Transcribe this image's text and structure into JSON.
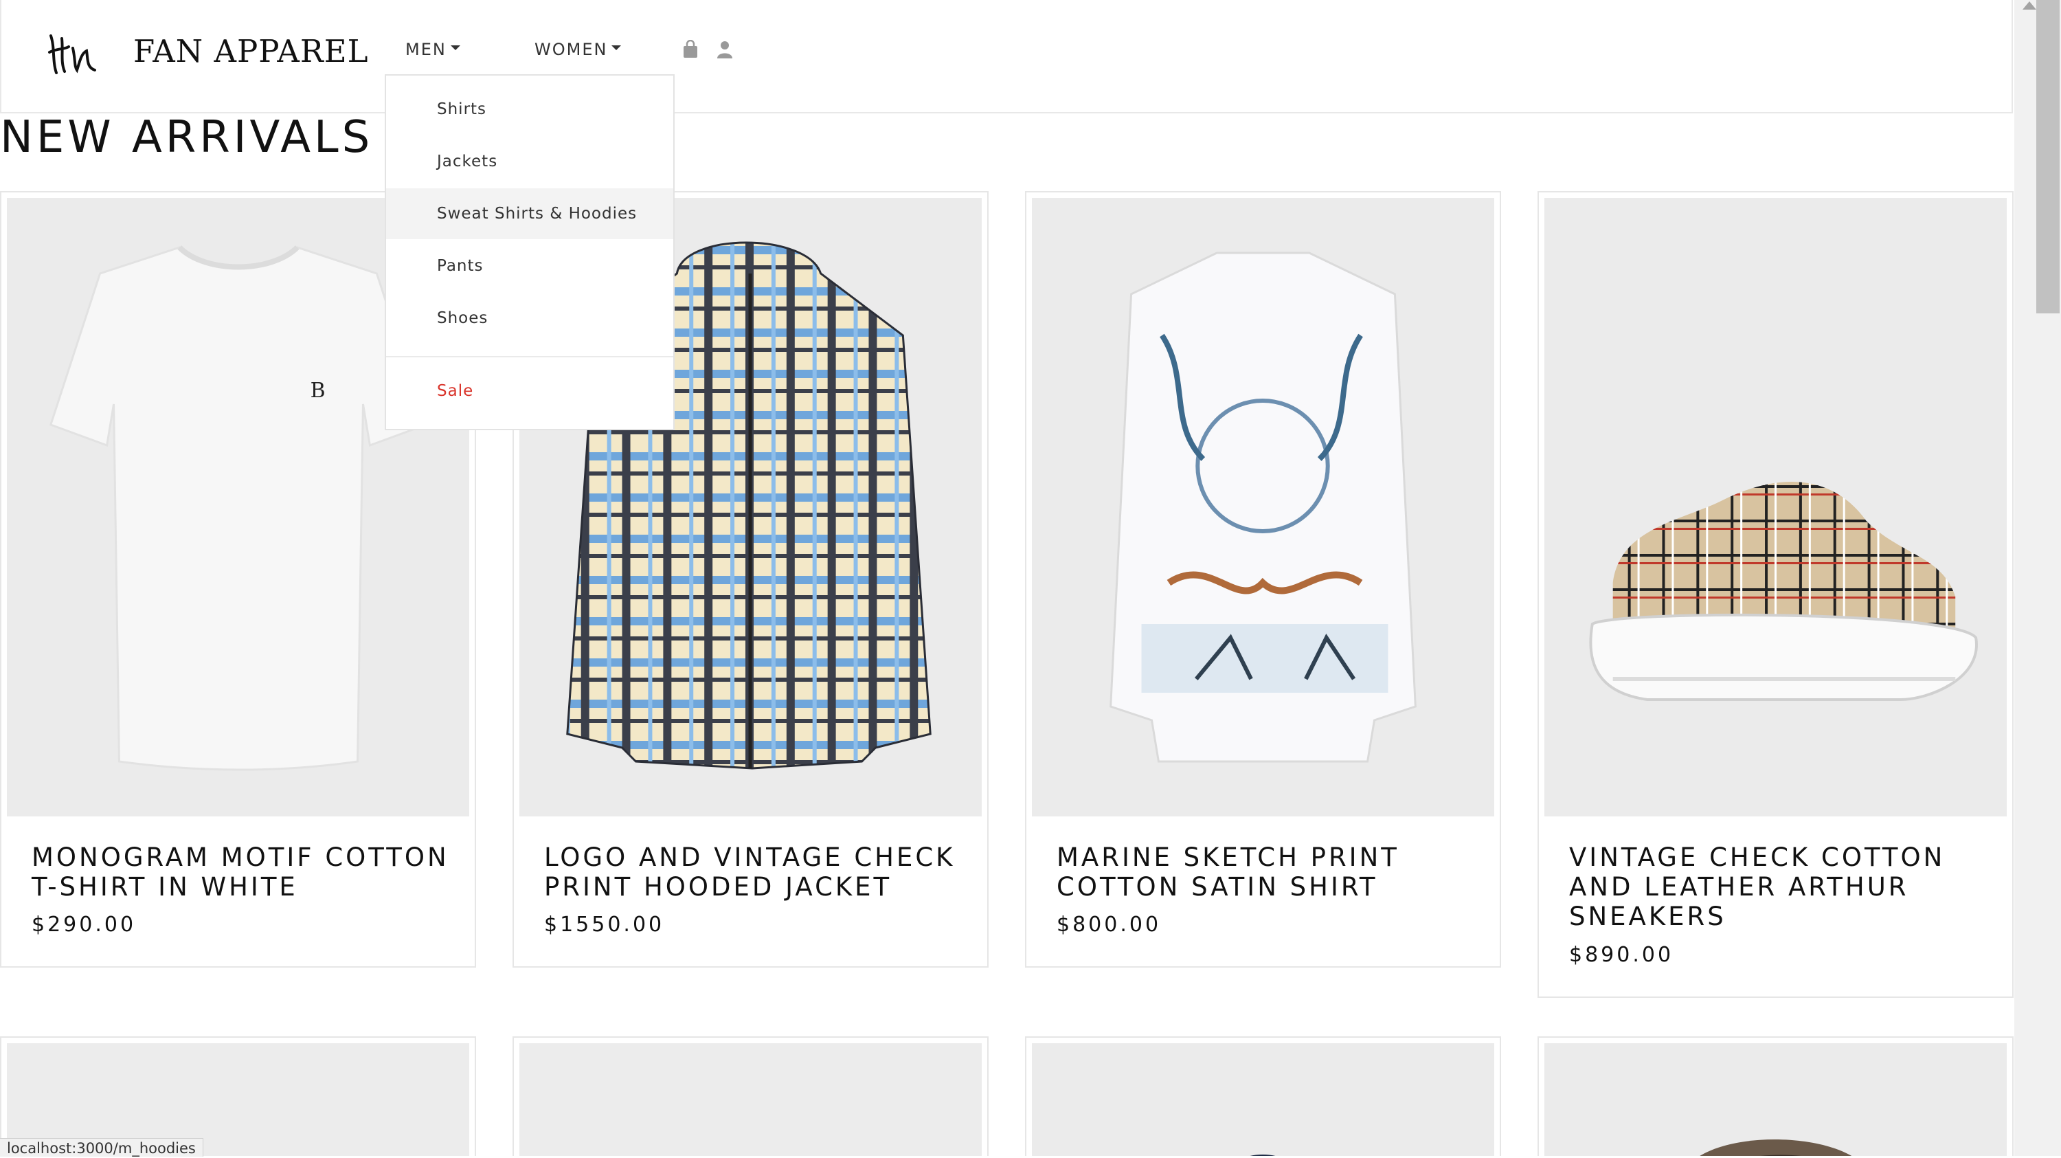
{
  "brand": {
    "name": "FAN APPAREL"
  },
  "nav": {
    "men": "MEN",
    "women": "WOMEN",
    "icons": [
      "bag-icon",
      "user-icon"
    ]
  },
  "page_title": "NEW ARRIVALS",
  "dropdown": {
    "items": [
      "Shirts",
      "Jackets",
      "Sweat Shirts & Hoodies",
      "Pants",
      "Shoes"
    ],
    "highlighted": "Sweat Shirts & Hoodies",
    "sale": "Sale",
    "sale_color": "#d9342b"
  },
  "products": [
    {
      "name": "MONOGRAM MOTIF COTTON T-SHIRT IN WHITE",
      "price": "$290.00"
    },
    {
      "name": "LOGO AND VINTAGE CHECK PRINT HOODED JACKET",
      "price": "$1550.00"
    },
    {
      "name": "MARINE SKETCH PRINT COTTON SATIN SHIRT",
      "price": "$800.00"
    },
    {
      "name": "VINTAGE CHECK COTTON AND LEATHER ARTHUR SNEAKERS",
      "price": "$890.00"
    }
  ],
  "status_bar": "localhost:3000/m_hoodies"
}
